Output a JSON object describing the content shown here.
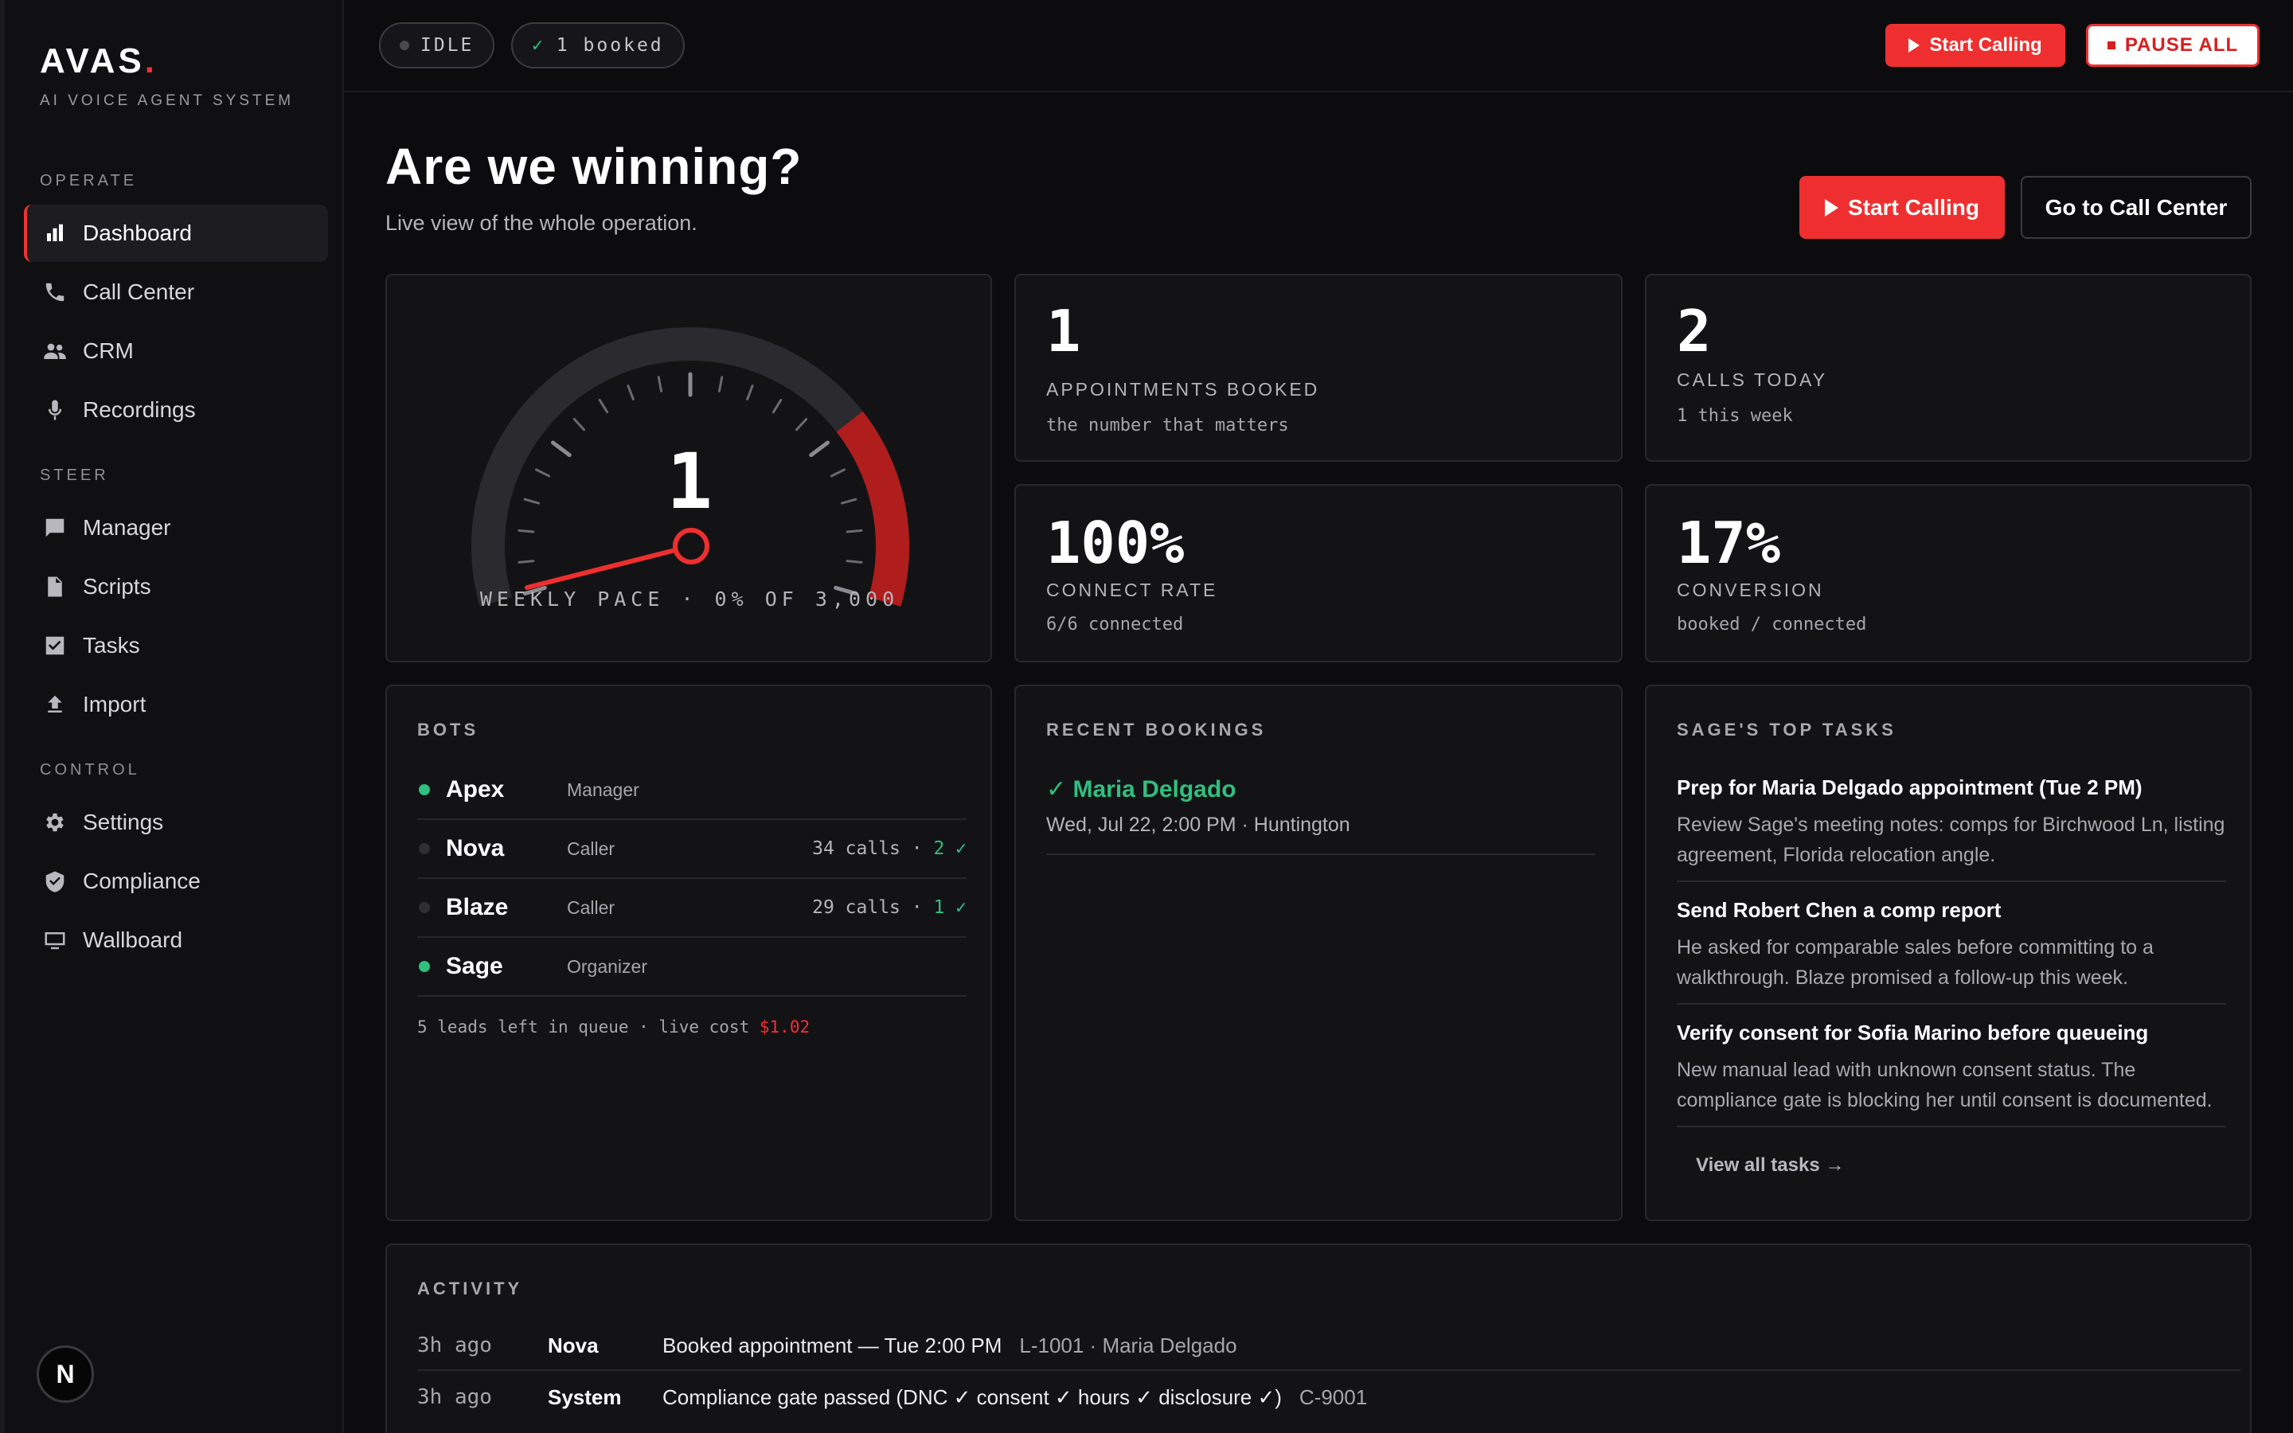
{
  "brand": {
    "name": "AVAS",
    "dot": ".",
    "subtitle": "AI VOICE AGENT SYSTEM"
  },
  "sidebar": {
    "sections": [
      {
        "title": "OPERATE",
        "items": [
          {
            "label": "Dashboard",
            "icon": "bar-chart-icon",
            "active": true
          },
          {
            "label": "Call Center",
            "icon": "phone-icon"
          },
          {
            "label": "CRM",
            "icon": "people-icon"
          },
          {
            "label": "Recordings",
            "icon": "microphone-icon"
          }
        ]
      },
      {
        "title": "STEER",
        "items": [
          {
            "label": "Manager",
            "icon": "chat-icon"
          },
          {
            "label": "Scripts",
            "icon": "document-icon"
          },
          {
            "label": "Tasks",
            "icon": "checkbox-icon"
          },
          {
            "label": "Import",
            "icon": "upload-icon"
          }
        ]
      },
      {
        "title": "CONTROL",
        "items": [
          {
            "label": "Settings",
            "icon": "gear-icon"
          },
          {
            "label": "Compliance",
            "icon": "shield-icon"
          },
          {
            "label": "Wallboard",
            "icon": "monitor-icon"
          }
        ]
      }
    ],
    "footer_badge": "N"
  },
  "topbar": {
    "status": "IDLE",
    "booked": "1 booked",
    "booked_check": "✓",
    "start_label": "Start Calling",
    "pause_label": "PAUSE ALL"
  },
  "header": {
    "title": "Are we winning?",
    "subtitle": "Live view of the whole operation.",
    "start_label": "Start Calling",
    "call_center_label": "Go to Call Center"
  },
  "gauge": {
    "value": "1",
    "caption": "WEEKLY PACE · 0% OF 3,000",
    "fraction": 0.0003
  },
  "stats": {
    "appointments": {
      "value": "1",
      "label": "APPOINTMENTS BOOKED",
      "sub": "the number that matters"
    },
    "calls": {
      "value": "2",
      "label": "CALLS TODAY",
      "sub": "1 this week"
    },
    "connect": {
      "value": "100%",
      "label": "CONNECT RATE",
      "sub": "6/6 connected"
    },
    "conversion": {
      "value": "17%",
      "label": "CONVERSION",
      "sub": "booked / connected"
    }
  },
  "bots": {
    "title": "BOTS",
    "rows": [
      {
        "name": "Apex",
        "role": "Manager",
        "calls": "",
        "booked": "",
        "online": true
      },
      {
        "name": "Nova",
        "role": "Caller",
        "calls": "34 calls ·",
        "booked": "2 ✓",
        "online": false
      },
      {
        "name": "Blaze",
        "role": "Caller",
        "calls": "29 calls ·",
        "booked": "1 ✓",
        "online": false
      },
      {
        "name": "Sage",
        "role": "Organizer",
        "calls": "",
        "booked": "",
        "online": true
      }
    ],
    "queue_text": "5 leads left in queue · live cost",
    "cost": "$1.02"
  },
  "recent_bookings": {
    "title": "RECENT BOOKINGS",
    "items": [
      {
        "name": "✓ Maria Delgado",
        "meta": "Wed, Jul 22, 2:00 PM · Huntington"
      }
    ]
  },
  "tasks": {
    "title": "SAGE'S TOP TASKS",
    "items": [
      {
        "title": "Prep for Maria Delgado appointment (Tue 2 PM)",
        "desc": "Review Sage's meeting notes: comps for Birchwood Ln, listing agreement, Florida relocation angle."
      },
      {
        "title": "Send Robert Chen a comp report",
        "desc": "He asked for comparable sales before committing to a walkthrough. Blaze promised a follow-up this week."
      },
      {
        "title": "Verify consent for Sofia Marino before queueing",
        "desc": "New manual lead with unknown consent status. The compliance gate is blocking her until consent is documented."
      }
    ],
    "view_all": "View all tasks →"
  },
  "activity": {
    "title": "ACTIVITY",
    "rows": [
      {
        "time": "3h ago",
        "who": "Nova",
        "what": "Booked appointment — Tue 2:00 PM",
        "ref": "L-1001 · Maria Delgado"
      },
      {
        "time": "3h ago",
        "who": "System",
        "what": "Compliance gate passed (DNC ✓ consent ✓ hours ✓ disclosure ✓)",
        "ref": "C-9001"
      }
    ]
  },
  "colors": {
    "accent": "#ef2f2f",
    "success": "#2fbf7f",
    "background": "#0c0c0e",
    "card": "#131316"
  }
}
